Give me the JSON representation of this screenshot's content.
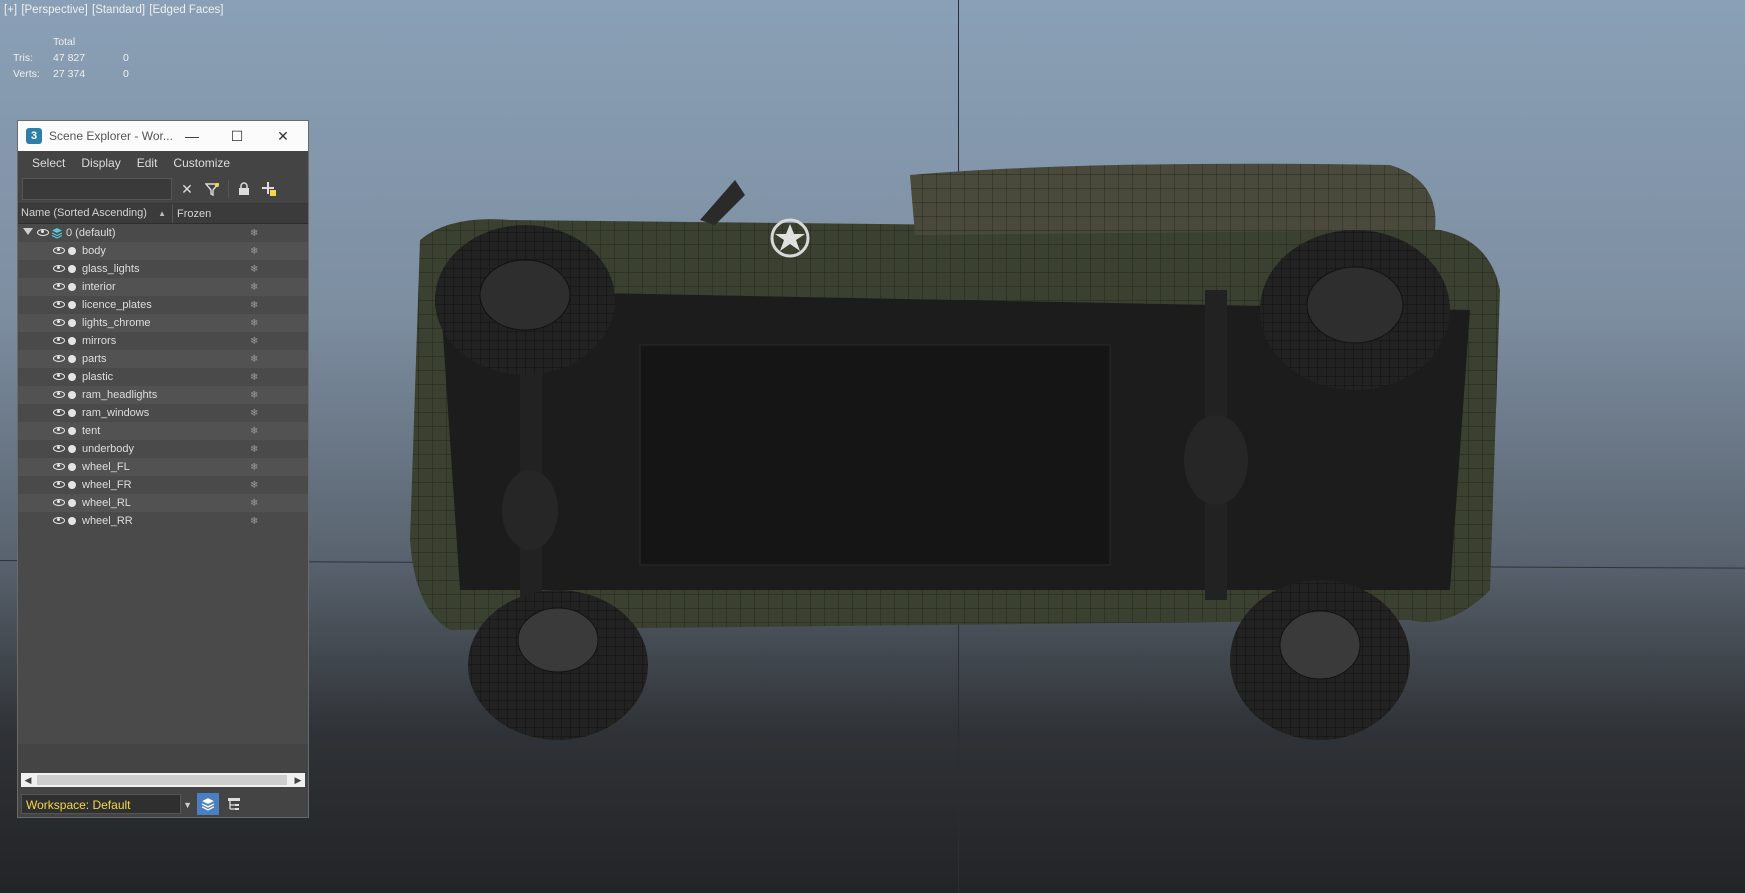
{
  "viewport": {
    "label_parts": [
      "[+]",
      "[Perspective]",
      "[Standard]",
      "[Edged Faces]"
    ],
    "stats": {
      "header": "Total",
      "rows": [
        {
          "label": "Tris:",
          "total": "47 827",
          "selected": "0"
        },
        {
          "label": "Verts:",
          "total": "27 374",
          "selected": "0"
        }
      ]
    }
  },
  "scene_explorer": {
    "title": "Scene Explorer - Wor...",
    "app_icon": "3",
    "window_buttons": {
      "minimize": "—",
      "maximize": "☐",
      "close": "✕"
    },
    "menus": [
      "Select",
      "Display",
      "Edit",
      "Customize"
    ],
    "toolbar_icons": [
      "clear-icon",
      "filter-icon",
      "lock-icon",
      "add-layer-icon"
    ],
    "columns": {
      "name": "Name (Sorted Ascending)",
      "frozen": "Frozen"
    },
    "root_layer": "0 (default)",
    "objects": [
      "body",
      "glass_lights",
      "interior",
      "licence_plates",
      "lights_chrome",
      "mirrors",
      "parts",
      "plastic",
      "ram_headlights",
      "ram_windows",
      "tent",
      "underbody",
      "wheel_FL",
      "wheel_FR",
      "wheel_RL",
      "wheel_RR"
    ],
    "workspace": "Workspace: Default"
  },
  "colors": {
    "workspace_text": "#f3d84a",
    "active_button": "#4a7fc1",
    "vehicle_body": "#3c4230",
    "vehicle_dark": "#1c1c1c"
  }
}
